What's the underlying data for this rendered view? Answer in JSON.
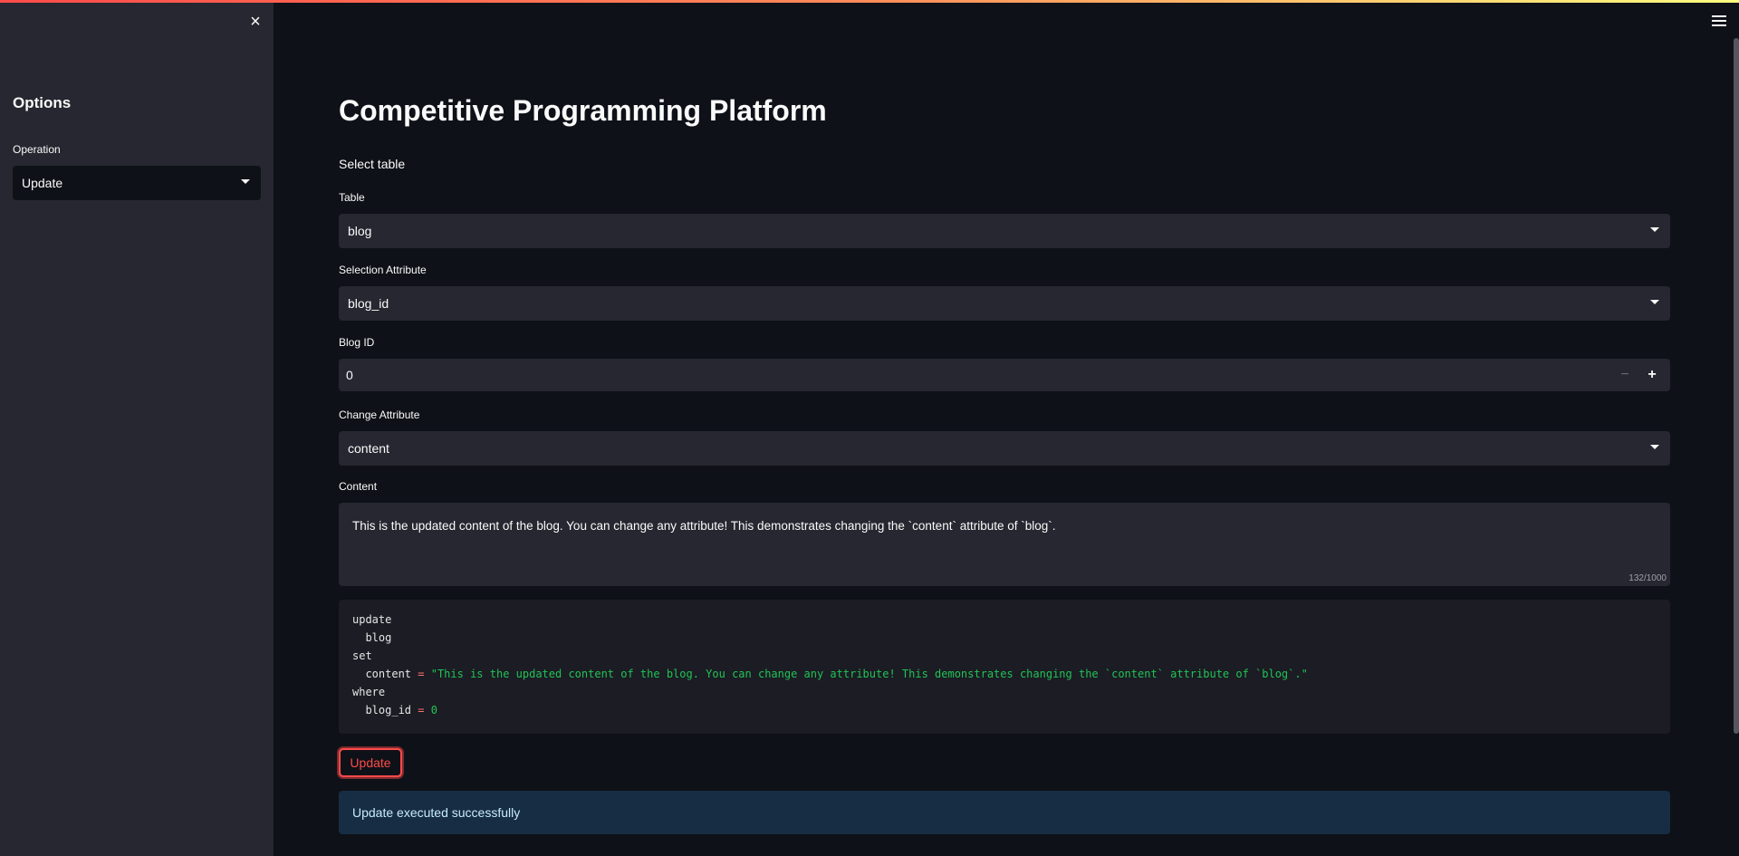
{
  "sidebar": {
    "title": "Options",
    "operation_label": "Operation",
    "operation_value": "Update",
    "close_icon": "×"
  },
  "main": {
    "title": "Competitive Programming Platform",
    "subheading": "Select table",
    "table": {
      "label": "Table",
      "value": "blog"
    },
    "selection_attribute": {
      "label": "Selection Attribute",
      "value": "blog_id"
    },
    "blog_id": {
      "label": "Blog ID",
      "value": "0",
      "minus": "−",
      "plus": "+"
    },
    "change_attribute": {
      "label": "Change Attribute",
      "value": "content"
    },
    "content": {
      "label": "Content",
      "value": "This is the updated content of the blog. You can change any attribute! This demonstrates changing the `content` attribute of `blog`.",
      "counter": "132/1000"
    },
    "sql": {
      "kw_update": "update",
      "table": "blog",
      "kw_set": "set",
      "column": "content",
      "op": "=",
      "string_value": "\"This is the updated content of the blog. You can change any attribute! This demonstrates changing the `content` attribute of `blog`.\"",
      "kw_where": "where",
      "where_column": "blog_id",
      "where_op": "=",
      "where_value": "0"
    },
    "update_button": "Update",
    "status_message": "Update executed successfully"
  },
  "colors": {
    "background": "#0e1117",
    "sidebar": "#262730",
    "accent": "#ff4b4b",
    "info_bg": "#172d43",
    "code_string": "#21c354"
  }
}
